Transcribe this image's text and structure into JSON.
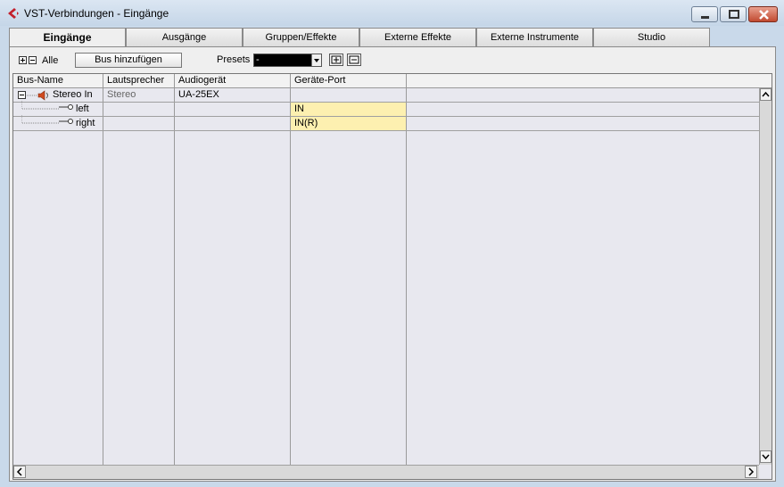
{
  "window": {
    "title": "VST-Verbindungen - Eingänge"
  },
  "tabs": [
    {
      "label": "Eingänge",
      "active": true
    },
    {
      "label": "Ausgänge",
      "active": false
    },
    {
      "label": "Gruppen/Effekte",
      "active": false
    },
    {
      "label": "Externe Effekte",
      "active": false
    },
    {
      "label": "Externe Instrumente",
      "active": false
    },
    {
      "label": "Studio",
      "active": false
    }
  ],
  "toolbar": {
    "all_label": "Alle",
    "add_bus_label": "Bus hinzufügen",
    "presets_label": "Presets",
    "presets_value": "-"
  },
  "grid": {
    "columns": [
      "Bus-Name",
      "Lautsprecher",
      "Audiogerät",
      "Geräte-Port"
    ],
    "rows": [
      {
        "bus_name": "Stereo In",
        "speaker": "Stereo",
        "device": "UA-25EX",
        "port": ""
      },
      {
        "bus_name": "left",
        "speaker": "",
        "device": "",
        "port": "IN"
      },
      {
        "bus_name": "right",
        "speaker": "",
        "device": "",
        "port": "IN(R)"
      }
    ]
  },
  "colors": {
    "port_highlight": "#fdf0b0",
    "window_bg": "#c9d9ea",
    "close_red": "#c14a30"
  }
}
